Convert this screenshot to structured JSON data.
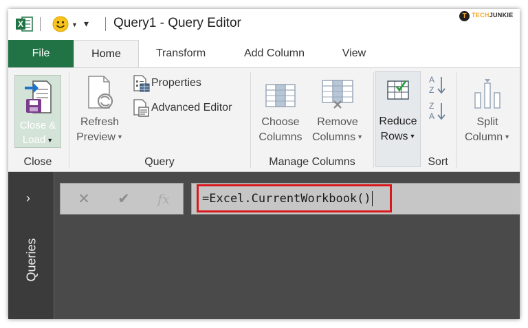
{
  "window": {
    "title": "Query1 - Query Editor",
    "app_icon": "excel-icon",
    "quick_access_icon": "smiley-icon"
  },
  "watermark": {
    "mark": "T",
    "text_a": "TECH",
    "text_b": "JUNKIE"
  },
  "tabs": [
    {
      "label": "File"
    },
    {
      "label": "Home"
    },
    {
      "label": "Transform"
    },
    {
      "label": "Add Column"
    },
    {
      "label": "View"
    }
  ],
  "ribbon": {
    "close": {
      "group_label": "Close",
      "close_load_label_1": "Close &",
      "close_load_label_2": "Load"
    },
    "query": {
      "group_label": "Query",
      "refresh_label_1": "Refresh",
      "refresh_label_2": "Preview",
      "properties_label": "Properties",
      "advanced_editor_label": "Advanced Editor"
    },
    "manage_columns": {
      "group_label": "Manage Columns",
      "choose_label_1": "Choose",
      "choose_label_2": "Columns",
      "remove_label_1": "Remove",
      "remove_label_2": "Columns"
    },
    "reduce_rows": {
      "label_1": "Reduce",
      "label_2": "Rows"
    },
    "sort": {
      "group_label": "Sort"
    },
    "split": {
      "label_1": "Split",
      "label_2": "Column"
    }
  },
  "queries_panel": {
    "label": "Queries"
  },
  "formula_bar": {
    "formula": "=Excel.CurrentWorkbook()",
    "fx_label": "fx"
  },
  "colors": {
    "file_tab": "#217346",
    "highlight_border": "#d9181c",
    "main_background": "#4a4a4a"
  }
}
